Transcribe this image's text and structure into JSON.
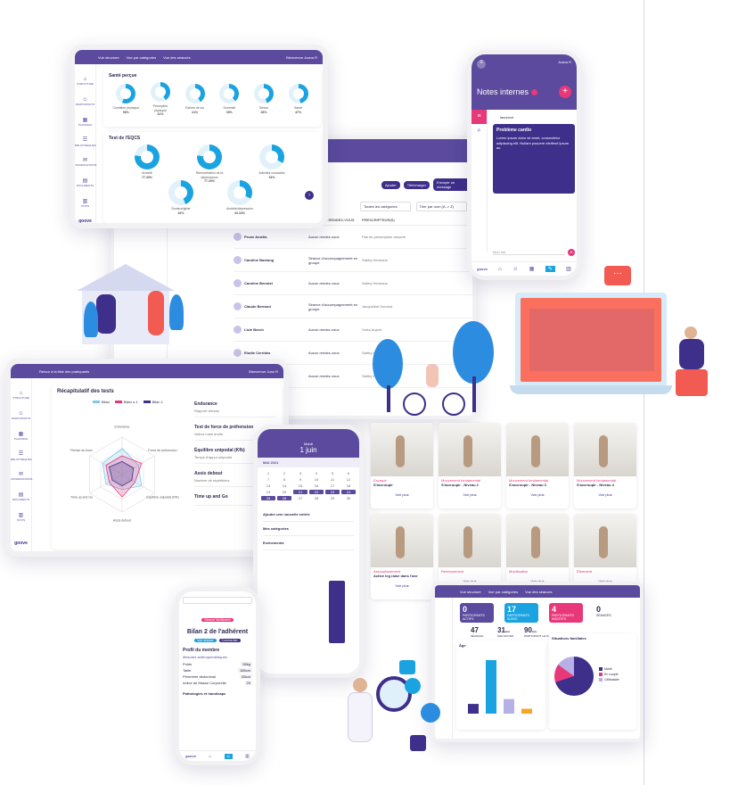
{
  "brand": "goove",
  "nav": [
    "STRUCTURE",
    "PARTICIPANTS",
    "PLANNING",
    "BIBLIOTHÈQUES",
    "CONVERSATIONS",
    "DOCUMENTS",
    "STATS"
  ],
  "tablet1": {
    "tabs": [
      "Vue structure",
      "Vue par catégories",
      "Vue des séances"
    ],
    "user": "Bienvenue Joana R",
    "section1": "Santé perçue",
    "donuts1": [
      {
        "label": "Condition physique",
        "value": "56%",
        "pct": 56
      },
      {
        "label": "Perception physique",
        "value": "41%",
        "pct": 41
      },
      {
        "label": "Estime de soi",
        "value": "41%",
        "pct": 41
      },
      {
        "label": "Sommeil",
        "value": "39%",
        "pct": 39
      },
      {
        "label": "Stress",
        "value": "45%",
        "pct": 45
      },
      {
        "label": "Santé",
        "value": "47%",
        "pct": 47
      }
    ],
    "section2": "Test de l'EQCS",
    "donuts2": [
      {
        "label": "Anxiété",
        "value": "77.39%",
        "pct": 77
      },
      {
        "label": "Rémunération de la dépendance",
        "value": "77.39%",
        "pct": 77
      },
      {
        "label": "Activités courantes",
        "value": "33%",
        "pct": 33
      },
      {
        "label": "Douleur/gêne",
        "value": "44%",
        "pct": 44
      },
      {
        "label": "Anxiété/dépression",
        "value": "33.33%",
        "pct": 33
      }
    ]
  },
  "desktop": {
    "actions": [
      "Ajouter",
      "Télécharger",
      "Envoyer un message"
    ],
    "filters": [
      "Toutes les catégories",
      "Trier par nom (A -> Z)"
    ],
    "columns": [
      "NOM",
      "PROCHAIN RENDEZ-VOUS",
      "PRESCRIPTEUR(S)"
    ],
    "rows": [
      {
        "name": "Prune Amelia",
        "next": "Aucun rendez-vous",
        "presc": "Pas de prescription associé"
      },
      {
        "name": "Caroline Bastung",
        "next": "Séance d'accompagnement en groupe",
        "presc": "Sabby Hermann"
      },
      {
        "name": "Caroline Benoist",
        "next": "Aucun rendez-vous",
        "presc": "Sabby Hermann"
      },
      {
        "name": "Claude Bernard",
        "next": "Séance d'accompagnement en groupe",
        "presc": "Jacqueline Dumont"
      },
      {
        "name": "Lisie Borch",
        "next": "Aucun rendez-vous",
        "presc": "Voies Aujord"
      },
      {
        "name": "Elodie Cerrides",
        "next": "Aucun rendez-vous",
        "presc": "Sabby Hermann"
      },
      {
        "name": "Jeanne Chenel",
        "next": "Aucun rendez-vous",
        "presc": "Sabby Hermann"
      }
    ]
  },
  "phone1": {
    "user": "Joana R",
    "title": "Notes internes",
    "author": "laurence",
    "problem_title": "Problème cardio",
    "problem_text": "Lorem ipsum dolor sit amet, consectetur adipiscing elit. Nullam posuere eleifend ipsum ac.",
    "input": "Mon nel"
  },
  "tablet2": {
    "back": "Retour à la liste des pratiquants",
    "user": "Bienvenue Joan R",
    "title": "Récapitulatif des tests",
    "legend": [
      "Bilan",
      "Bilan n-1",
      "Bilan 1"
    ],
    "axes": [
      "Endurance",
      "Force de préhension",
      "Équilibre unipodal (Kfb)",
      "Assis debout",
      "Time up and Go",
      "Flexion du tronc"
    ],
    "tests": [
      {
        "name": "Endurance",
        "detail": "Rapport vitesse"
      },
      {
        "name": "Test de force de préhension",
        "detail": "Valeur main droite"
      },
      {
        "name": "Équilibre unipodal (Kfb)",
        "detail": "Temps d'appui unipodal"
      },
      {
        "name": "Assis debout",
        "detail": "Nombre de répétitions"
      },
      {
        "name": "Time up and Go",
        "detail": ""
      }
    ]
  },
  "planning": {
    "month": "MAI 2021",
    "day": "Mardi",
    "date": "1 juin",
    "menu": [
      "Ajouter une nouvelle entrée",
      "Mes catégories",
      "Evénements"
    ]
  },
  "exercises": [
    {
      "title": "Escarpé",
      "sub": "S'accroupir",
      "btn": "Voir plus"
    },
    {
      "title": "Mouvement fondamental",
      "sub": "S'accroupir - Niveau 2",
      "btn": "Voir plus"
    },
    {
      "title": "Mouvement fondamental",
      "sub": "S'accroupir - Niveau 3",
      "btn": "Voir plus"
    },
    {
      "title": "Mouvement fondamental",
      "sub": "S'accroupir - Niveau 4",
      "btn": "Voir plus"
    },
    {
      "title": "Assouplissement",
      "sub": "Active leg raise dans l'axe",
      "btn": "Voir plus"
    },
    {
      "title": "Renforcement",
      "sub": "",
      "btn": "Voir plus"
    },
    {
      "title": "Mobilisation",
      "sub": "",
      "btn": "Voir plus"
    },
    {
      "title": "Étirement",
      "sub": "",
      "btn": "Voir plus"
    }
  ],
  "phone2": {
    "tag": "Séance Multiactive",
    "title": "Bilan 2 de l'adhérent",
    "btn1": "Voir séance",
    "btn2": "Commenter",
    "section": "Profil du membre",
    "subsection": "Mesures anthropométriques",
    "fields": [
      {
        "k": "Poids",
        "v": "55kg"
      },
      {
        "k": "Taille",
        "v": "165cm"
      },
      {
        "k": "Périmètre abdominal",
        "v": "85cm"
      },
      {
        "k": "Indice de Masse Corporelle",
        "v": "20"
      }
    ],
    "section2": "Pathologies et handicaps"
  },
  "dashboard": {
    "tabs": [
      "Vue structure",
      "Vue par catégories",
      "Vue des séances"
    ],
    "stats": [
      {
        "v": "0",
        "l": "PARTICIPANTS ACTIFS",
        "color": "#5b4a9e"
      },
      {
        "v": "17",
        "l": "PARTICIPANTS SUIVIS",
        "color": "#1aa3e0"
      },
      {
        "v": "4",
        "l": "PARTICIPANTS INSCRITS",
        "color": "#e8387a"
      },
      {
        "v": "0",
        "l": "SÉANCES",
        "color": "#ffffff"
      }
    ],
    "mini": [
      {
        "v": "47",
        "l": "SÉANCES"
      },
      {
        "v": "31",
        "u": "ans",
        "l": "ÂGE MOYEN"
      },
      {
        "v": "90",
        "u": "ans",
        "l": "PARTICIPANT LE PLUS ÂGÉ"
      }
    ],
    "chart1": "Âge",
    "chart2": "Situations familiales",
    "legend2": [
      "Marié",
      "En couple",
      "Célibataire"
    ],
    "bars": [
      2,
      11,
      3,
      1
    ]
  }
}
